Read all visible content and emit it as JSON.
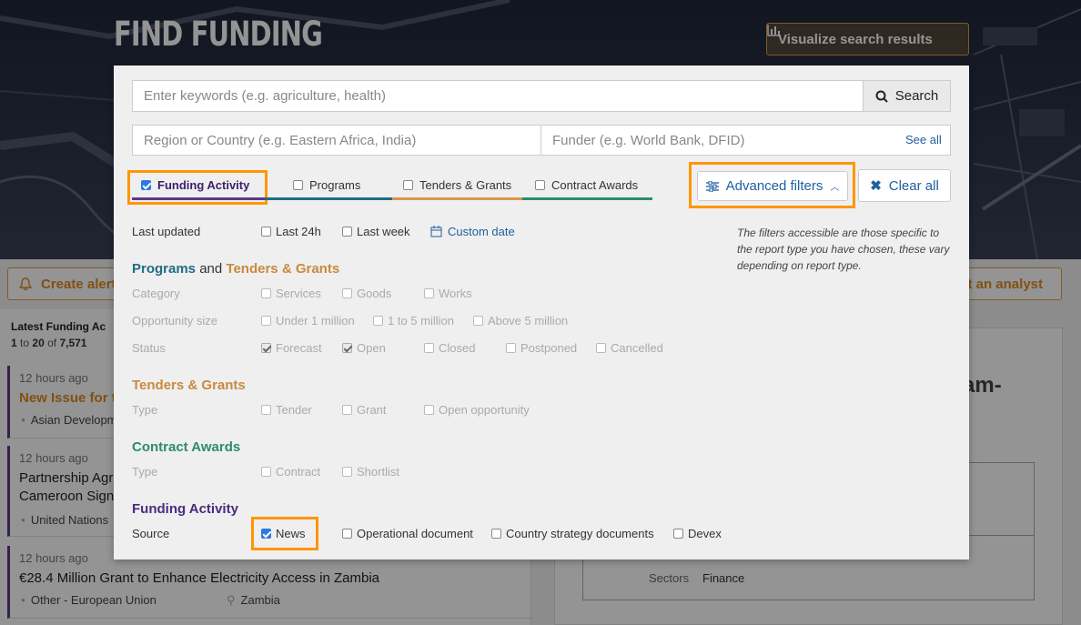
{
  "header": {
    "title": "FIND FUNDING",
    "visualize_label": "Visualize search results"
  },
  "background": {
    "create_alert_label": "Create alert",
    "analyst_label": "t an analyst",
    "list_heading": "Latest Funding Ac",
    "count": {
      "from": "1",
      "to_word": "to",
      "to": "20",
      "of_word": "of",
      "total": "7,571"
    },
    "cards": [
      {
        "ago": "12 hours ago",
        "title": "New Issue for t",
        "org": "Asian Developm",
        "location": ""
      },
      {
        "ago": "12 hours ago",
        "title": "Partnership Agr",
        "title2": "Cameroon Sign",
        "org": "United Nations",
        "location": ""
      },
      {
        "ago": "12 hours ago",
        "title": "€28.4 Million Grant to Enhance Electricity Access in Zambia",
        "org": "Other - European Union",
        "location": "Zambia"
      }
    ],
    "detail": {
      "title_fragment": "am-",
      "sectors_label": "Sectors",
      "sectors_value": "Finance"
    }
  },
  "search": {
    "keywords_placeholder": "Enter keywords (e.g. agriculture, health)",
    "search_label": "Search",
    "region_placeholder": "Region or Country (e.g. Eastern Africa, India)",
    "funder_placeholder": "Funder (e.g. World Bank, DFID)",
    "see_all_label": "See all"
  },
  "tabs": [
    {
      "label": "Funding Activity",
      "checked": true,
      "color": "#5a3a8c"
    },
    {
      "label": "Programs",
      "checked": false,
      "color": "#1f6d82"
    },
    {
      "label": "Tenders & Grants",
      "checked": false,
      "color": "#d9964a"
    },
    {
      "label": "Contract Awards",
      "checked": false,
      "color": "#2e8b6e"
    }
  ],
  "advanced_filters_label": "Advanced filters",
  "clear_all_label": "Clear all",
  "note": "The filters accessible are those specific to the report type you have chosen, these vary depending on report type.",
  "last_updated": {
    "label": "Last updated",
    "options": [
      "Last 24h",
      "Last week"
    ],
    "custom_date_label": "Custom date"
  },
  "programs_section": {
    "title_a": "Programs",
    "title_and": "and",
    "title_b": "Tenders & Grants",
    "category": {
      "label": "Category",
      "options": [
        "Services",
        "Goods",
        "Works"
      ]
    },
    "opportunity_size": {
      "label": "Opportunity size",
      "options": [
        "Under 1 million",
        "1 to 5 million",
        "Above 5 million"
      ]
    },
    "status": {
      "label": "Status",
      "options": [
        "Forecast",
        "Open",
        "Closed",
        "Postponed",
        "Cancelled"
      ],
      "checked": [
        "Forecast",
        "Open"
      ]
    }
  },
  "tenders_section": {
    "title": "Tenders & Grants",
    "type_label": "Type",
    "options": [
      "Tender",
      "Grant",
      "Open opportunity"
    ]
  },
  "contract_section": {
    "title": "Contract Awards",
    "type_label": "Type",
    "options": [
      "Contract",
      "Shortlist"
    ]
  },
  "funding_section": {
    "title": "Funding Activity",
    "source_label": "Source",
    "options": [
      "News",
      "Operational document",
      "Country strategy documents",
      "Devex"
    ],
    "checked": [
      "News"
    ]
  },
  "colors": {
    "highlight": "#ff9600",
    "link": "#1f5f9f",
    "accent_orange": "#e08a1f"
  }
}
